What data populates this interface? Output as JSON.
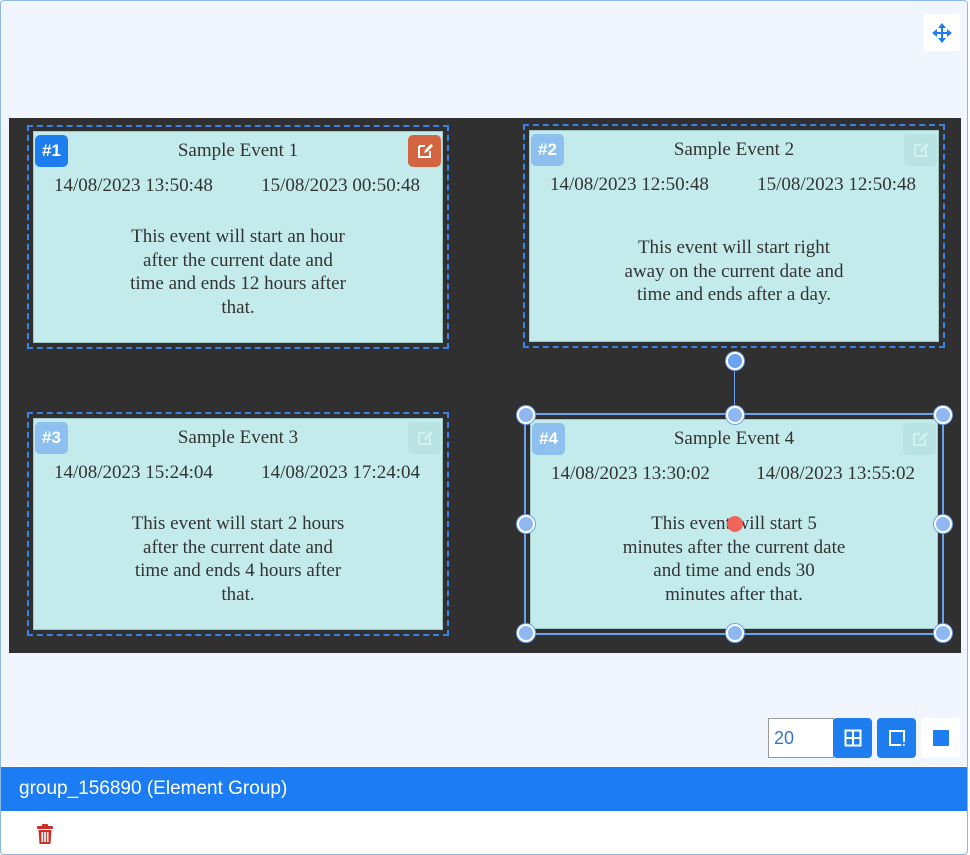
{
  "toolbar": {
    "move_icon": "move-arrows-icon",
    "grid_size": "20",
    "grid_icon": "grid-icon",
    "snap_icon": "snap-frame-icon",
    "square_icon": "square-icon"
  },
  "group": {
    "label": "group_156890 (Element Group)",
    "delete_icon": "trash-icon"
  },
  "colors": {
    "accent": "#1e7ef0",
    "edit_active": "#d2643f",
    "card_bg": "#c3ebeb",
    "canvas_bg": "#303030"
  },
  "events": [
    {
      "badge": "#1",
      "title": "Sample Event 1",
      "start": "14/08/2023 13:50:48",
      "end": "15/08/2023 00:50:48",
      "description": "This event will start an hour after the current date and time and ends 12 hours after that.",
      "edit_icon": "edit-icon"
    },
    {
      "badge": "#2",
      "title": "Sample Event 2",
      "start": "14/08/2023 12:50:48",
      "end": "15/08/2023 12:50:48",
      "description": "This event will start right away on the current date and time and ends after a day.",
      "edit_icon": "edit-icon"
    },
    {
      "badge": "#3",
      "title": "Sample Event 3",
      "start": "14/08/2023 15:24:04",
      "end": "14/08/2023 17:24:04",
      "description": "This event will start 2 hours after the current date and time and ends 4 hours after that.",
      "edit_icon": "edit-icon"
    },
    {
      "badge": "#4",
      "title": "Sample Event 4",
      "start": "14/08/2023 13:30:02",
      "end": "14/08/2023 13:55:02",
      "description": "This event will start 5 minutes after the current date and time and ends 30 minutes after that.",
      "edit_icon": "edit-icon"
    }
  ]
}
